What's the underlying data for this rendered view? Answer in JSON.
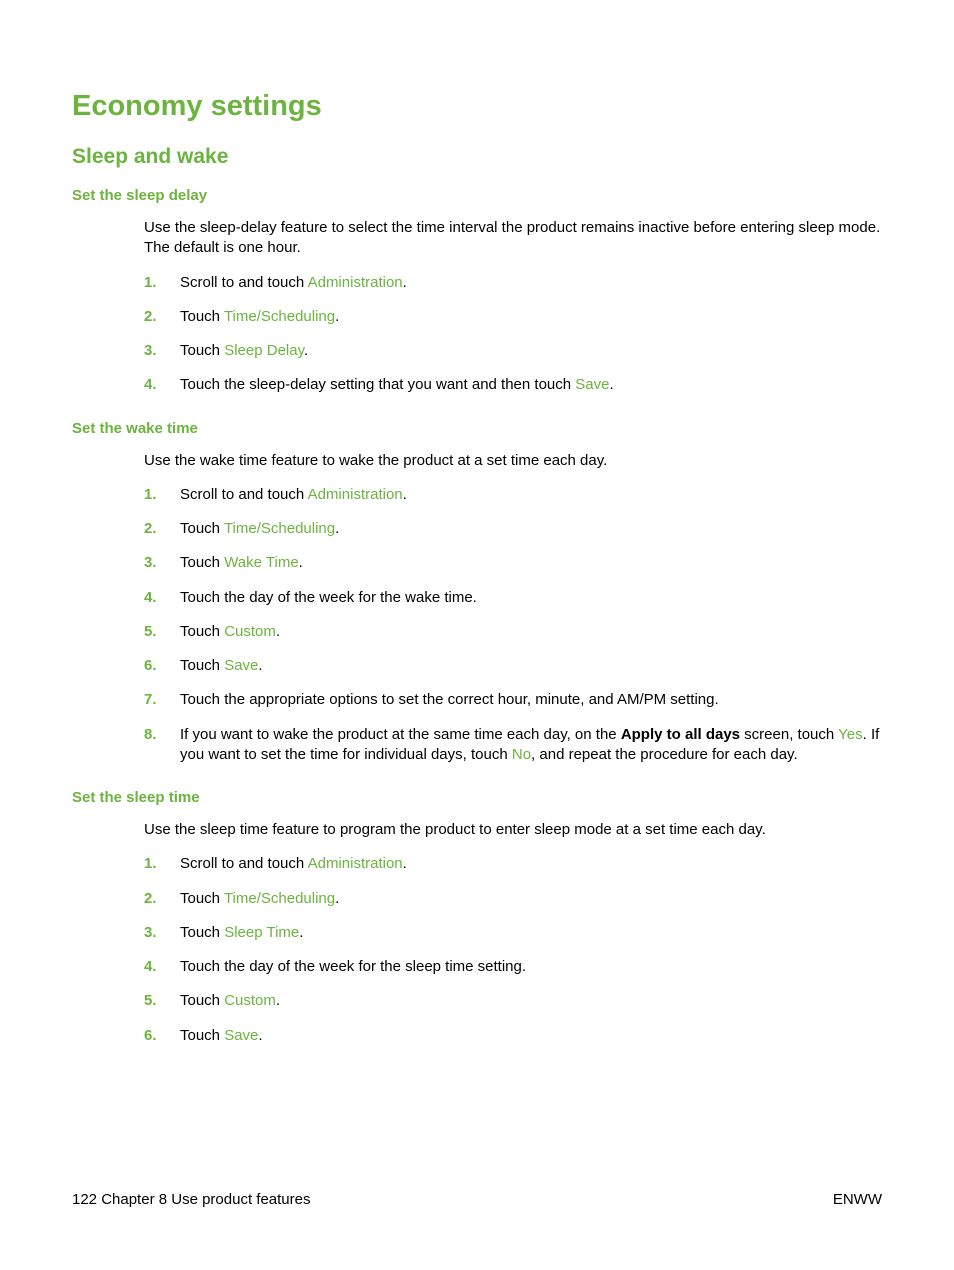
{
  "h1": "Economy settings",
  "h2": "Sleep and wake",
  "section1": {
    "title": "Set the sleep delay",
    "intro": "Use the sleep-delay feature to select the time interval the product remains inactive before entering sleep mode. The default is one hour.",
    "steps": {
      "s1a": "Scroll to and touch ",
      "s1b": "Administration",
      "s1c": ".",
      "s2a": "Touch ",
      "s2b": "Time/Scheduling",
      "s2c": ".",
      "s3a": "Touch ",
      "s3b": "Sleep Delay",
      "s3c": ".",
      "s4a": "Touch the sleep-delay setting that you want and then touch ",
      "s4b": "Save",
      "s4c": "."
    }
  },
  "section2": {
    "title": "Set the wake time",
    "intro": "Use the wake time feature to wake the product at a set time each day.",
    "steps": {
      "s1a": "Scroll to and touch ",
      "s1b": "Administration",
      "s1c": ".",
      "s2a": "Touch ",
      "s2b": "Time/Scheduling",
      "s2c": ".",
      "s3a": "Touch ",
      "s3b": "Wake Time",
      "s3c": ".",
      "s4": "Touch the day of the week for the wake time.",
      "s5a": "Touch ",
      "s5b": "Custom",
      "s5c": ".",
      "s6a": "Touch ",
      "s6b": "Save",
      "s6c": ".",
      "s7": "Touch the appropriate options to set the correct hour, minute, and AM/PM setting.",
      "s8a": "If you want to wake the product at the same time each day, on the ",
      "s8b": "Apply to all days",
      "s8c": " screen, touch ",
      "s8d": "Yes",
      "s8e": ". If you want to set the time for individual days, touch ",
      "s8f": "No",
      "s8g": ", and repeat the procedure for each day."
    }
  },
  "section3": {
    "title": "Set the sleep time",
    "intro": "Use the sleep time feature to program the product to enter sleep mode at a set time each day.",
    "steps": {
      "s1a": "Scroll to and touch ",
      "s1b": "Administration",
      "s1c": ".",
      "s2a": "Touch ",
      "s2b": "Time/Scheduling",
      "s2c": ".",
      "s3a": "Touch ",
      "s3b": "Sleep Time",
      "s3c": ".",
      "s4": "Touch the day of the week for the sleep time setting.",
      "s5a": "Touch ",
      "s5b": "Custom",
      "s5c": ".",
      "s6a": "Touch ",
      "s6b": "Save",
      "s6c": "."
    }
  },
  "nums": {
    "n1": "1.",
    "n2": "2.",
    "n3": "3.",
    "n4": "4.",
    "n5": "5.",
    "n6": "6.",
    "n7": "7.",
    "n8": "8."
  },
  "footer": {
    "left": "122   Chapter 8    Use product features",
    "right": "ENWW"
  }
}
